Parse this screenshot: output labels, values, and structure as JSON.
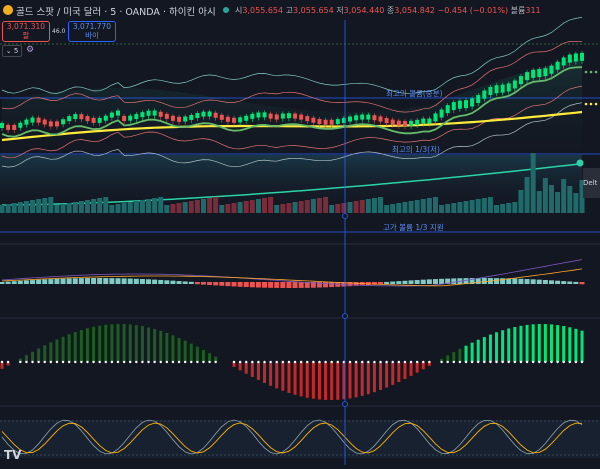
{
  "header": {
    "title": "골드 스팟 / 미국 달러 · 5 · OANDA · 하이킨 아시",
    "ohlc_open_label": "시",
    "ohlc_open": "3,055.654",
    "ohlc_high_label": "고",
    "ohlc_high": "3,055.654",
    "ohlc_low_label": "저",
    "ohlc_low": "3,054.440",
    "ohlc_close_label": "종",
    "ohlc_close": "3,054.842",
    "change": "−0.454 (−0.01%)",
    "volume_label": "볼륨",
    "volume": "311"
  },
  "trade": {
    "sell_price": "3,071.310",
    "sell_label": "팔",
    "spread": "46.0",
    "buy_price": "3,071.770",
    "buy_label": "바이"
  },
  "indicators_toggle": "5",
  "labels": {
    "highest_volume": "최고의 볼륨(중분)",
    "lowest_volume": "최고의 1/3(저)",
    "high_volume_support": "고가 볼륨 1/3 지원",
    "delta_tag": "Delt"
  },
  "colors": {
    "bg": "#131722",
    "up": "#00e676",
    "down": "#ef5350",
    "gold_ma": "#ffeb3b",
    "green_ma": "#66bb6a",
    "teal": "#26a69a",
    "cross": "#2962ff"
  },
  "logo": "TV"
}
